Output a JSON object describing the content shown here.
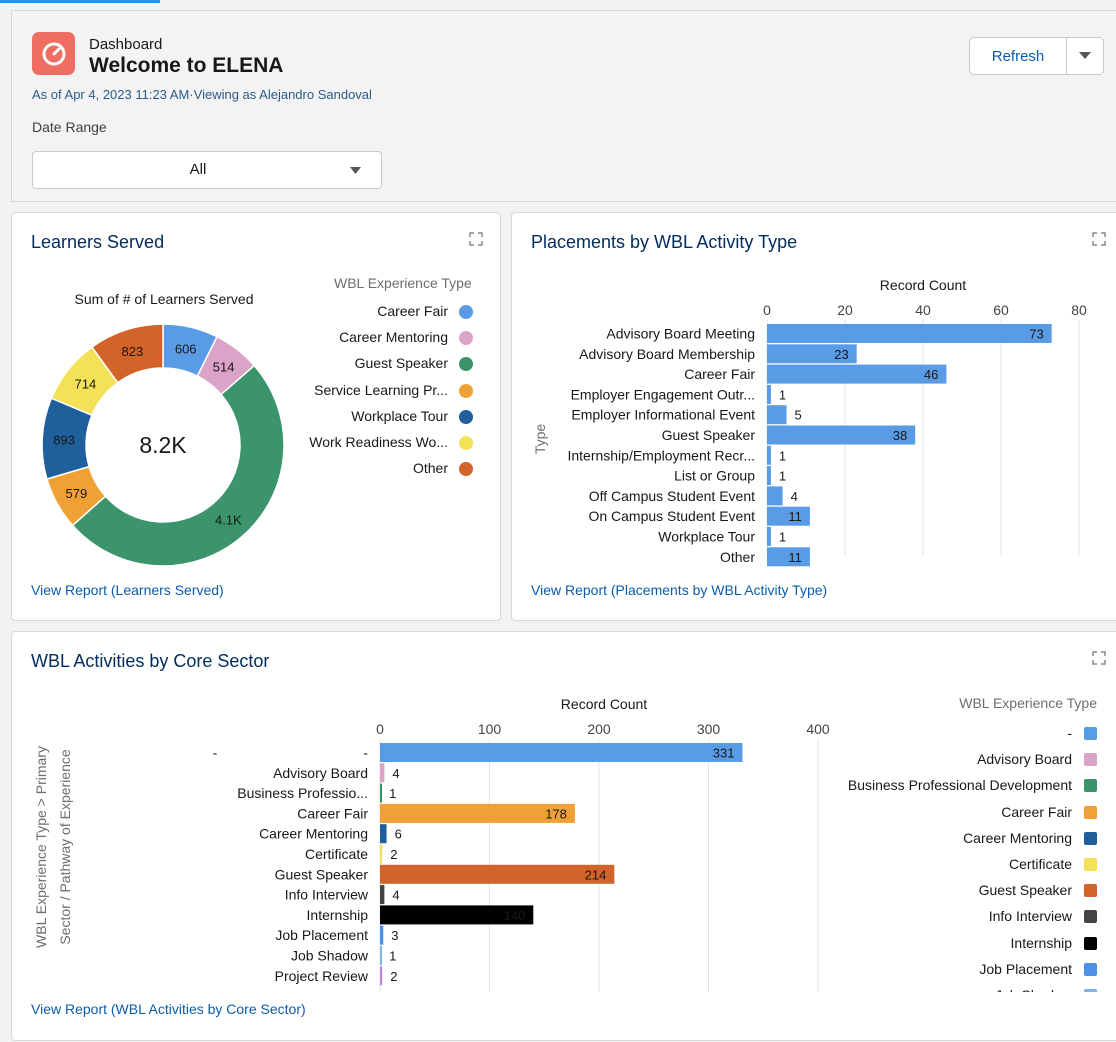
{
  "header": {
    "eyebrow": "Dashboard",
    "title": "Welcome to ELENA",
    "subtitle": "As of Apr 4, 2023 11:23 AM·Viewing as Alejandro Sandoval",
    "refresh_label": "Refresh",
    "filter_label": "Date Range",
    "filter_value": "All"
  },
  "learners": {
    "title": "Learners Served",
    "chart_title": "Sum of # of Learners Served",
    "total": "8.2K",
    "link": "View Report (Learners Served)",
    "legend_title": "WBL Experience Type"
  },
  "placements": {
    "title": "Placements by WBL Activity Type",
    "link": "View Report (Placements by WBL Activity Type)"
  },
  "sectors": {
    "title": "WBL Activities by Core Sector",
    "link": "View Report (WBL Activities by Core Sector)",
    "legend_title": "WBL Experience Type",
    "legend": [
      {
        "label": "-",
        "color": "#5a9be6"
      },
      {
        "label": "Advisory Board",
        "color": "#dba3c8"
      },
      {
        "label": "Business Professional Development",
        "color": "#3b946b"
      },
      {
        "label": "Career Fair",
        "color": "#f0a135"
      },
      {
        "label": "Career Mentoring",
        "color": "#1e5f9c"
      },
      {
        "label": "Certificate",
        "color": "#f5e157"
      },
      {
        "label": "Guest Speaker",
        "color": "#d2642a"
      },
      {
        "label": "Info Interview",
        "color": "#444444"
      },
      {
        "label": "Internship",
        "color": "#000000"
      },
      {
        "label": "Job Placement",
        "color": "#4e92e8"
      },
      {
        "label": "Job Shadow",
        "color": "#7fb3ec"
      }
    ]
  },
  "chart_data": [
    {
      "type": "pie",
      "title": "Sum of # of Learners Served",
      "legend_title": "WBL Experience Type",
      "center_label": "8.2K",
      "slices": [
        {
          "label": "Career Fair",
          "value": 606,
          "display": "606",
          "color": "#5a9be6"
        },
        {
          "label": "Career Mentoring",
          "value": 514,
          "display": "514",
          "color": "#dba3c8"
        },
        {
          "label": "Guest Speaker",
          "value": 4100,
          "display": "4.1K",
          "color": "#3b946b"
        },
        {
          "label": "Service Learning Pr...",
          "value": 579,
          "display": "579",
          "color": "#f0a135"
        },
        {
          "label": "Workplace Tour",
          "value": 893,
          "display": "893",
          "color": "#1e5f9c"
        },
        {
          "label": "Work Readiness Wo...",
          "value": 714,
          "display": "714",
          "color": "#f5e157"
        },
        {
          "label": "Other",
          "value": 823,
          "display": "823",
          "color": "#d2642a"
        }
      ]
    },
    {
      "type": "bar",
      "orientation": "horizontal",
      "xlabel": "Record Count",
      "ylabel": "Type",
      "xlim": [
        0,
        80
      ],
      "ticks": [
        0,
        20,
        40,
        60,
        80
      ],
      "color": "#5a9be6",
      "categories": [
        "Advisory Board Meeting",
        "Advisory Board Membership",
        "Career Fair",
        "Employer Engagement Outr...",
        "Employer Informational Event",
        "Guest Speaker",
        "Internship/Employment Recr...",
        "List or Group",
        "Off Campus Student Event",
        "On Campus Student Event",
        "Workplace Tour",
        "Other"
      ],
      "values": [
        73,
        23,
        46,
        1,
        5,
        38,
        1,
        1,
        4,
        11,
        1,
        11
      ]
    },
    {
      "type": "bar",
      "orientation": "horizontal",
      "xlabel": "Record Count",
      "ylabel": "WBL Experience Type  >  Primary Sector / Pathway of Experience",
      "xlim": [
        0,
        400
      ],
      "ticks": [
        0,
        100,
        200,
        300,
        400
      ],
      "categories": [
        "-",
        "Advisory Board",
        "Business Professio...",
        "Career Fair",
        "Career Mentoring",
        "Certificate",
        "Guest Speaker",
        "Info Interview",
        "Internship",
        "Job Placement",
        "Job Shadow",
        "Project Review"
      ],
      "group_labels": [
        "-",
        "",
        "",
        "",
        "",
        "",
        "",
        "",
        "",
        "",
        "",
        ""
      ],
      "values": [
        331,
        4,
        1,
        178,
        6,
        2,
        214,
        4,
        140,
        3,
        1,
        2
      ],
      "colors": [
        "#5a9be6",
        "#dba3c8",
        "#3b946b",
        "#f0a135",
        "#1e5f9c",
        "#f5e157",
        "#d2642a",
        "#444444",
        "#000000",
        "#4e92e8",
        "#7fb3ec",
        "#b388e6"
      ]
    }
  ]
}
